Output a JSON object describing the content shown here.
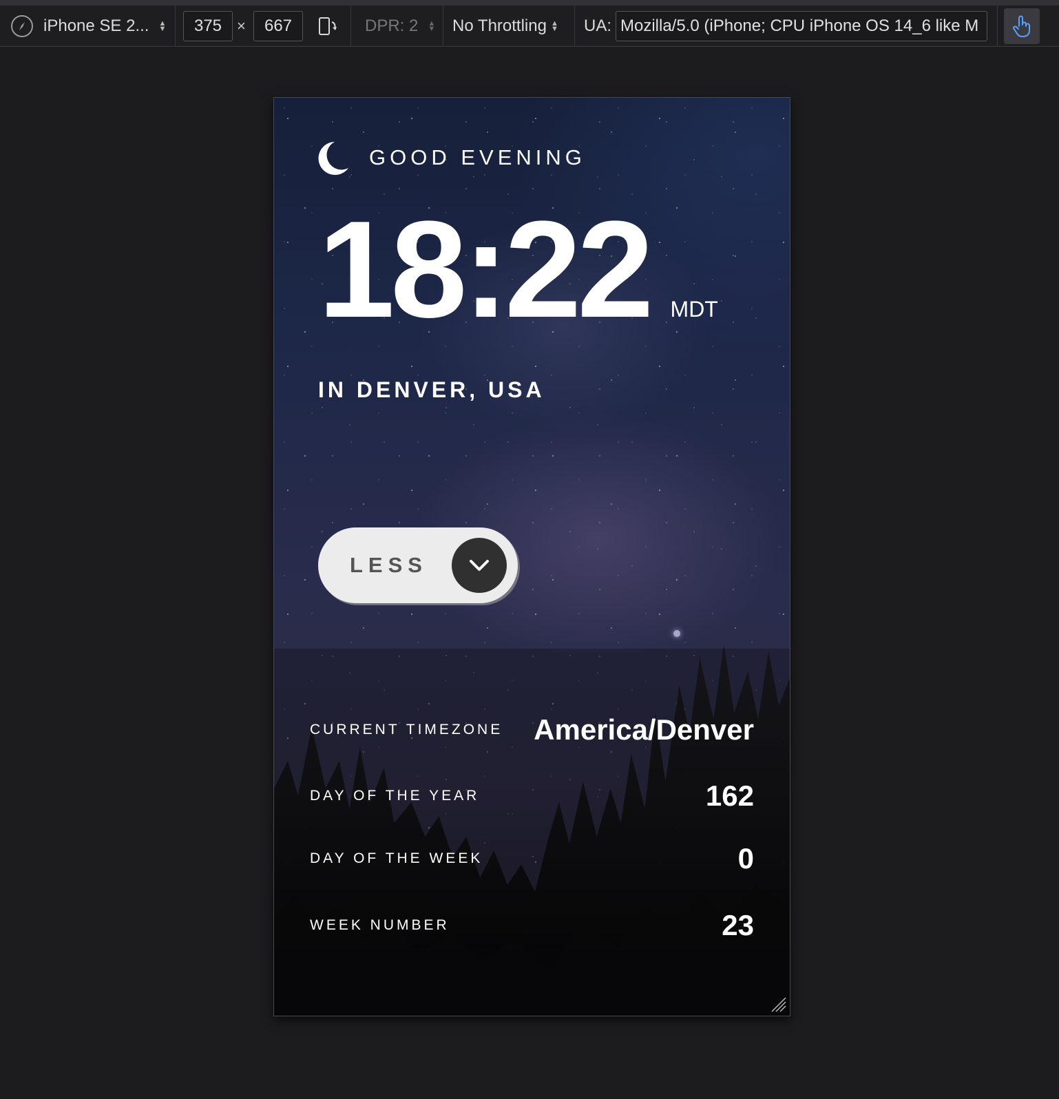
{
  "toolbar": {
    "device_name": "iPhone SE 2...",
    "width_value": "375",
    "times_sign": "×",
    "height_value": "667",
    "dpr_label": "DPR: 2",
    "throttling_label": "No Throttling",
    "ua_label": "UA:",
    "ua_value": "Mozilla/5.0 (iPhone; CPU iPhone OS 14_6 like M"
  },
  "app": {
    "greeting": "GOOD EVENING",
    "greeting_icon": "moon-icon",
    "time": "18:22",
    "timezone_abbr": "MDT",
    "location": "IN DENVER, USA",
    "toggle_label": "LESS",
    "toggle_icon": "chevron-down-icon",
    "details": [
      {
        "label": "CURRENT TIMEZONE",
        "value": "America/Denver"
      },
      {
        "label": "DAY OF THE YEAR",
        "value": "162"
      },
      {
        "label": "DAY OF THE WEEK",
        "value": "0"
      },
      {
        "label": "WEEK NUMBER",
        "value": "23"
      }
    ]
  },
  "colors": {
    "toggle_bg": "#ececec",
    "toggle_circle": "#303030",
    "toolbar_bg": "#1e1e20",
    "touch_icon": "#5aa0ff"
  }
}
